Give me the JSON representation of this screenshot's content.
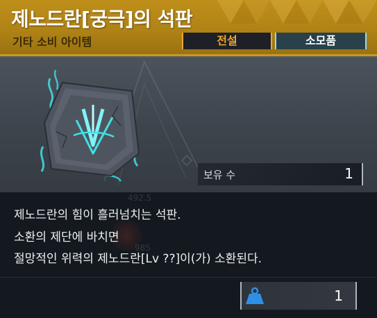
{
  "header": {
    "title": "제노드란[궁극]의 석판",
    "subtitle": "기타 소비 아이템",
    "tags": {
      "rarity": "전설",
      "category": "소모품"
    }
  },
  "item": {
    "icon": "glowing-stone-tablet-icon",
    "owned_label": "보유 수",
    "owned_count": "1"
  },
  "background_ghost": {
    "number_1": "492.5",
    "number_2": "985"
  },
  "description": {
    "line_1": "제노드란의 힘이 흘러넘치는 석판.",
    "line_2": "소환의 제단에 바치면",
    "line_3": "절망적인 위력의 제노드란[Lv ??]이(가) 소환된다."
  },
  "footer": {
    "weight_icon": "weight-icon",
    "weight_value": "1"
  },
  "colors": {
    "header_gold": "#b08316",
    "legend_orange": "#f0a630",
    "consumable_cyan": "#8fdcff",
    "glow_cyan": "#3fe0e8",
    "weight_blue": "#2f8fe6"
  }
}
